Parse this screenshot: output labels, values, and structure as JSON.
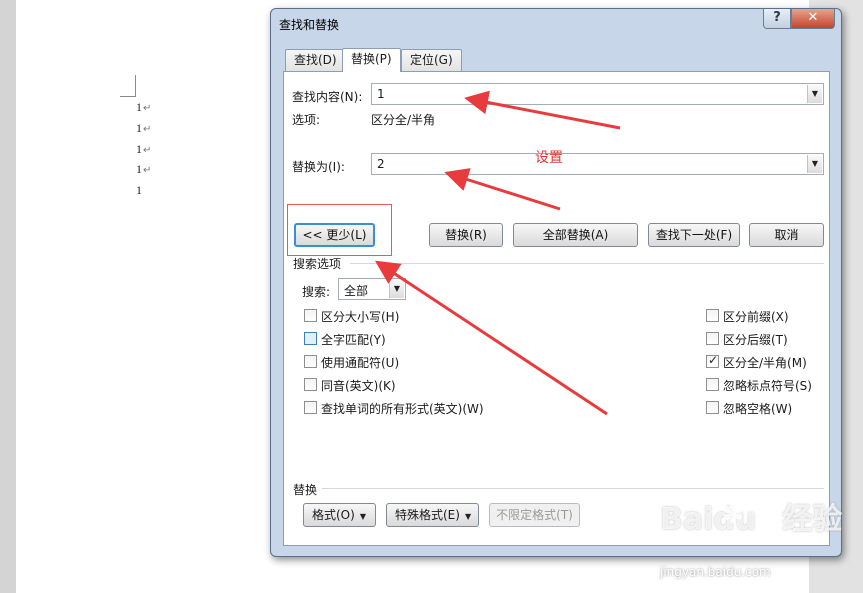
{
  "document": {
    "lines": [
      "1",
      "1",
      "1",
      "1",
      "1"
    ],
    "para_mark": "↵"
  },
  "dialog": {
    "title": "查找和替换",
    "help_glyph": "?",
    "close_glyph": "✕",
    "tabs": [
      {
        "label": "查找(D)",
        "active": false
      },
      {
        "label": "替换(P)",
        "active": true
      },
      {
        "label": "定位(G)",
        "active": false
      }
    ],
    "find": {
      "label": "查找内容(N):",
      "value": "1"
    },
    "options": {
      "label": "选项:",
      "value": "区分全/半角"
    },
    "replace_with": {
      "label": "替换为(I):",
      "value": "2"
    },
    "buttons": {
      "less": "<< 更少(L)",
      "replace": "替换(R)",
      "replace_all": "全部替换(A)",
      "find_next": "查找下一处(F)",
      "cancel": "取消"
    },
    "search_options": {
      "heading": "搜索选项",
      "search_label": "搜索:",
      "search_value": "全部",
      "left_checks": [
        {
          "label": "区分大小写(H)",
          "checked": false
        },
        {
          "label": "全字匹配(Y)",
          "checked": false
        },
        {
          "label": "使用通配符(U)",
          "checked": false
        },
        {
          "label": "同音(英文)(K)",
          "checked": false
        },
        {
          "label": "查找单词的所有形式(英文)(W)",
          "checked": false
        }
      ],
      "right_checks": [
        {
          "label": "区分前缀(X)",
          "checked": false
        },
        {
          "label": "区分后缀(T)",
          "checked": false
        },
        {
          "label": "区分全/半角(M)",
          "checked": true
        },
        {
          "label": "忽略标点符号(S)",
          "checked": false
        },
        {
          "label": "忽略空格(W)",
          "checked": false
        }
      ]
    },
    "replace_section": {
      "heading": "替换",
      "format": "格式(O)",
      "special": "特殊格式(E)",
      "no_format": "不限定格式(T)"
    }
  },
  "annotation": {
    "text": "设置",
    "color": "#e0393c"
  },
  "watermark": {
    "brand": "Baidu",
    "brand_cn": "经验",
    "url": "jingyan.baidu.com"
  },
  "icons": {
    "dropdown": "chevron-down-icon",
    "check": "checkmark-icon"
  }
}
